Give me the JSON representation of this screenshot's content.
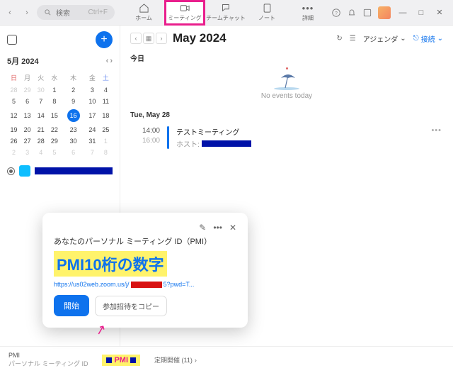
{
  "topbar": {
    "search_label": "検索",
    "search_hint": "Ctrl+F",
    "tabs": {
      "home": "ホーム",
      "meeting": "ミーティング",
      "teamchat": "チームチャット",
      "note": "ノート",
      "more": "詳細"
    }
  },
  "win": {
    "min": "—",
    "max": "□",
    "close": "✕"
  },
  "calendar": {
    "header": "5月  2024",
    "dow": [
      "日",
      "月",
      "火",
      "水",
      "木",
      "金",
      "土"
    ],
    "grid": [
      [
        "28",
        "29",
        "30",
        "1",
        "2",
        "3",
        "4"
      ],
      [
        "5",
        "6",
        "7",
        "8",
        "9",
        "10",
        "11"
      ],
      [
        "12",
        "13",
        "14",
        "15",
        "16",
        "17",
        "18"
      ],
      [
        "19",
        "20",
        "21",
        "22",
        "23",
        "24",
        "25"
      ],
      [
        "26",
        "27",
        "28",
        "29",
        "30",
        "31",
        "1"
      ],
      [
        "2",
        "3",
        "4",
        "5",
        "6",
        "7",
        "8"
      ]
    ],
    "off_first": 3,
    "off_last_from": 5,
    "today_r": 2,
    "today_c": 4
  },
  "content": {
    "title": "May 2024",
    "agenda": "アジェンダ",
    "connect": "接続",
    "today_label": "今日",
    "no_events": "No events today",
    "day2_label": "Tue, May 28",
    "event": {
      "t1": "14:00",
      "t2": "16:00",
      "title": "テストミーティング",
      "host": "ホスト:"
    }
  },
  "popup": {
    "title": "あなたのパーソナル ミーティング ID（PMI）",
    "annotation": "PMI10桁の数字",
    "link_a": "https://us02web.zoom.us/j/",
    "link_b": "5?pwd=T...",
    "start": "開始",
    "copy": "参加招待をコピー"
  },
  "footer": {
    "l1": "PMI",
    "l2": "パーソナル ミーティング ID",
    "pmi_tag": "PMI",
    "schedule": "定期開催 (11)"
  }
}
